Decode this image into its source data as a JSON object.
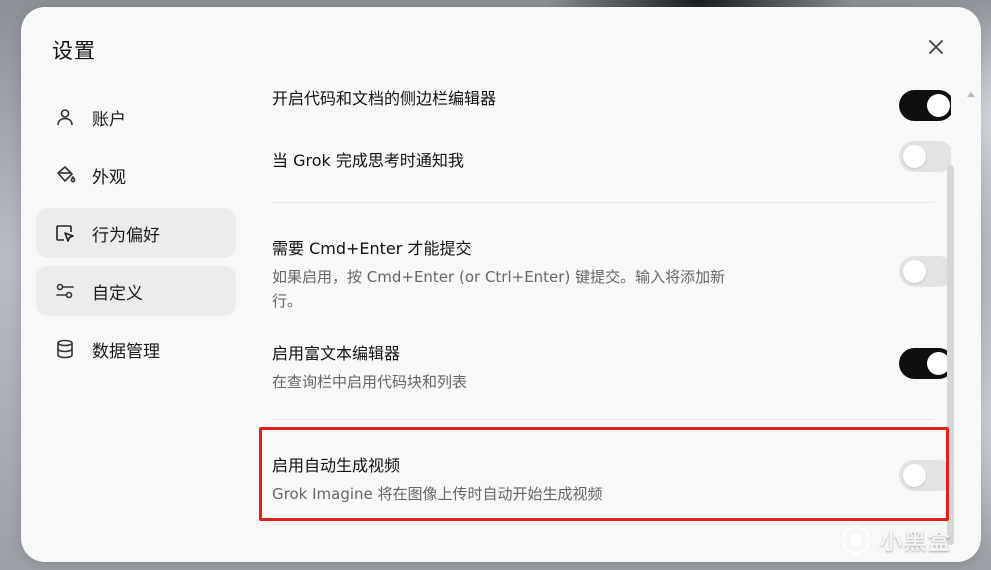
{
  "dialog": {
    "title": "设置"
  },
  "sidebar": {
    "items": [
      {
        "label": "账户",
        "icon": "user-icon"
      },
      {
        "label": "外观",
        "icon": "paint-bucket-icon"
      },
      {
        "label": "行为偏好",
        "icon": "cursor-square-icon",
        "active": true
      },
      {
        "label": "自定义",
        "icon": "sliders-icon"
      },
      {
        "label": "数据管理",
        "icon": "database-icon"
      }
    ]
  },
  "settings": [
    {
      "title": "开启代码和文档的侧边栏编辑器",
      "enabled": true
    },
    {
      "title": "当 Grok 完成思考时通知我",
      "enabled": false
    },
    {
      "title": "需要 Cmd+Enter 才能提交",
      "description": "如果启用，按 Cmd+Enter (or Ctrl+Enter) 键提交。输入将添加新行。",
      "enabled": false
    },
    {
      "title": "启用富文本编辑器",
      "description": "在查询栏中启用代码块和列表",
      "enabled": true
    },
    {
      "title": "启用自动生成视频",
      "description": "Grok Imagine 将在图像上传时自动开始生成视频",
      "enabled": false
    }
  ],
  "watermark": "小黑盒",
  "colors": {
    "highlight": "#e0201c",
    "toggle_on": "#0f0f0f",
    "toggle_off": "#e3e3e3"
  }
}
